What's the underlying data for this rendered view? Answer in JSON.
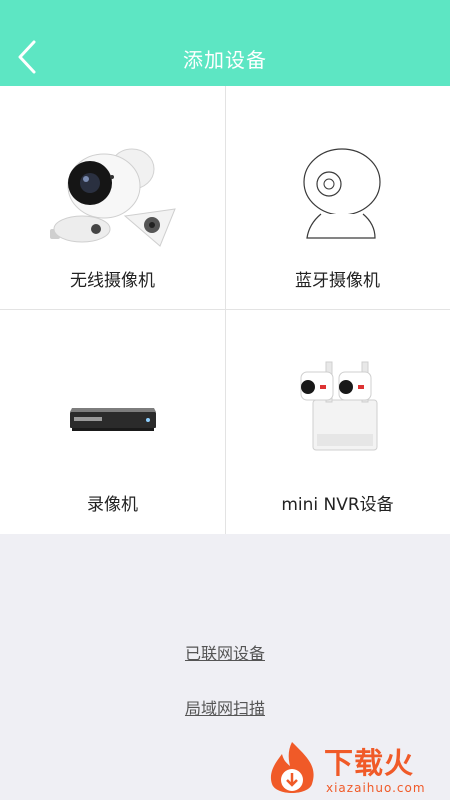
{
  "header": {
    "title": "添加设备"
  },
  "devices": [
    {
      "label": "无线摄像机",
      "icon": "wireless-camera-icon"
    },
    {
      "label": "蓝牙摄像机",
      "icon": "bluetooth-camera-icon"
    },
    {
      "label": "录像机",
      "icon": "nvr-recorder-icon"
    },
    {
      "label": "mini NVR设备",
      "icon": "mini-nvr-kit-icon"
    }
  ],
  "links": {
    "connected": "已联网设备",
    "lan_scan": "局域网扫描"
  },
  "watermark": {
    "title": "下载火",
    "url": "xiazaihuo.com"
  },
  "colors": {
    "header": "#5de6c3",
    "background": "#efeff4",
    "watermark": "#f05a28"
  }
}
